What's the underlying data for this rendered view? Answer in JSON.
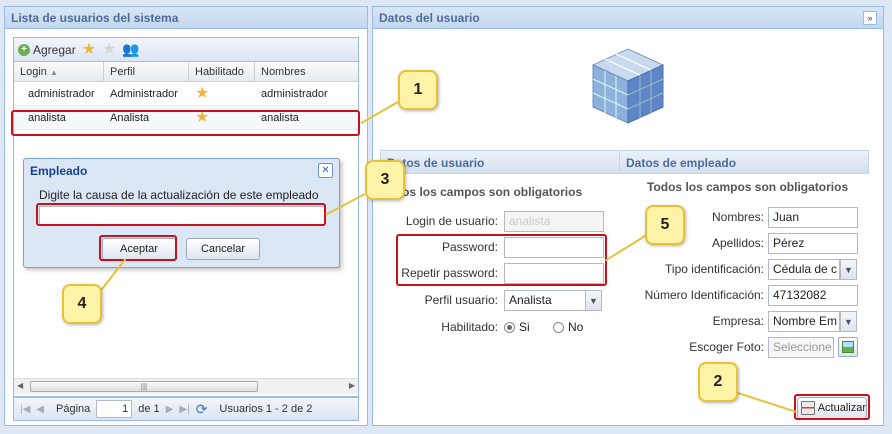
{
  "left_panel": {
    "title": "Lista de usuarios del sistema",
    "toolbar": {
      "add_label": "Agregar"
    },
    "columns": [
      "Login",
      "Perfil",
      "Habilitado",
      "Nombres"
    ],
    "rows": [
      {
        "login": "administrador",
        "perfil": "Administrador",
        "nombres": "administrador"
      },
      {
        "login": "analista",
        "perfil": "Analista",
        "nombres": "analista"
      }
    ],
    "paging": {
      "page_label": "Página",
      "page_value": "1",
      "of_label": "de 1",
      "summary": "Usuarios 1 - 2 de 2"
    }
  },
  "dialog": {
    "title": "Empleado",
    "prompt": "Digite la causa de la actualización de este empleado",
    "input_value": "",
    "accept_label": "Aceptar",
    "cancel_label": "Cancelar"
  },
  "right_panel": {
    "title": "Datos del usuario",
    "user_section": {
      "title": "Datos de usuario",
      "note": "Todos los campos son obligatorios",
      "login_label": "Login de usuario:",
      "login_value": "analista",
      "password_label": "Password:",
      "repeat_label": "Repetir password:",
      "perfil_label": "Perfil usuario:",
      "perfil_value": "Analista",
      "habilitado_label": "Habilitado:",
      "si_label": "Si",
      "no_label": "No"
    },
    "employee_section": {
      "title": "Datos de empleado",
      "note": "Todos los campos son obligatorios",
      "nombres_label": "Nombres:",
      "nombres_value": "Juan",
      "apellidos_label": "Apellidos:",
      "apellidos_value": "Pérez",
      "tipo_label": "Tipo identificación:",
      "tipo_value": "Cédula de c",
      "numero_label": "Número Identificación:",
      "numero_value": "47132082",
      "empresa_label": "Empresa:",
      "empresa_value": "Nombre Em",
      "foto_label": "Escoger Foto:",
      "foto_placeholder": "Seleccione"
    },
    "update_label": "Actualizar"
  },
  "callouts": [
    "1",
    "2",
    "3",
    "4",
    "5"
  ],
  "colors": {
    "highlight": "#c8101e",
    "callout": "#fff3a8"
  }
}
